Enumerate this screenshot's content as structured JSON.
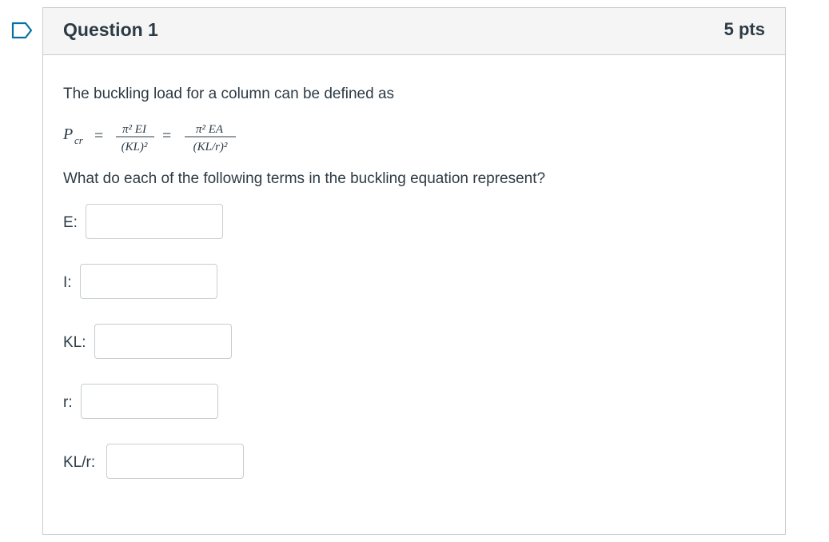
{
  "question": {
    "title": "Question 1",
    "points": "5 pts",
    "prompt": "The buckling load for a column can be defined as",
    "formula": {
      "lhs_symbol": "P",
      "lhs_subscript": "cr",
      "term1_numerator": "π² EI",
      "term1_denominator": "(KL)²",
      "term2_numerator": "π² EA",
      "term2_denominator": "(KL/r)²"
    },
    "instruction": "What do each of the following terms in the buckling equation represent?",
    "fields": [
      {
        "label": "E:",
        "value": ""
      },
      {
        "label": "I:",
        "value": ""
      },
      {
        "label": "KL:",
        "value": ""
      },
      {
        "label": "r:",
        "value": ""
      },
      {
        "label": "KL/r:",
        "value": ""
      }
    ]
  },
  "colors": {
    "flag_outline": "#0770a3",
    "header_bg": "#f5f5f5",
    "border": "#c7cdd1",
    "text": "#2d3b45"
  },
  "icons": {
    "flag": "bookmark-flag-icon"
  }
}
